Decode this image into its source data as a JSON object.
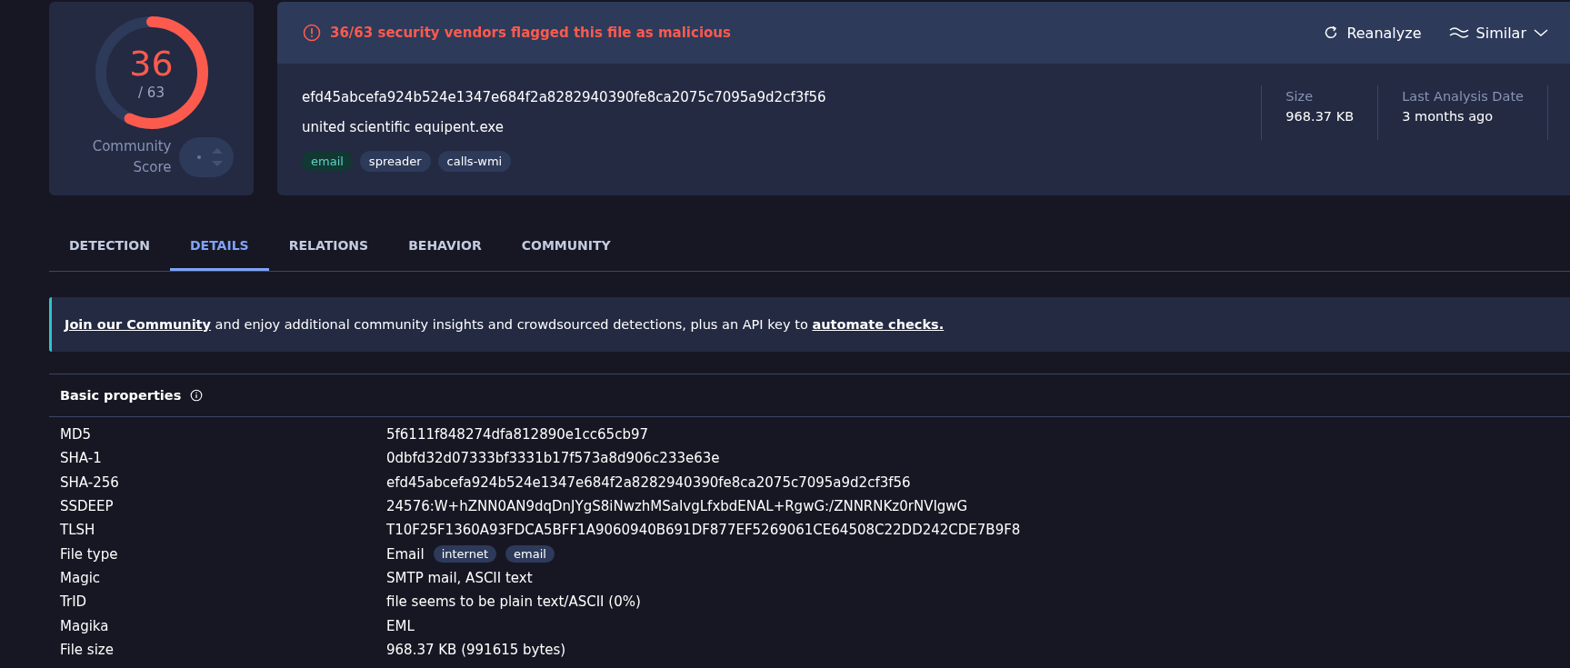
{
  "score": {
    "detections": "36",
    "total": "/ 63",
    "level": 0.571,
    "community_label": "Community Score"
  },
  "alert": {
    "text": "36/63 security vendors flagged this file as malicious"
  },
  "actions": [
    {
      "label": "Reanalyze",
      "kind": "reanalyze"
    },
    {
      "label": "Similar",
      "kind": "similar"
    }
  ],
  "file": {
    "hash": "efd45abcefa924b524e1347e684f2a8282940390fe8ca2075c7095a9d2cf3f56",
    "name": "united scientific equipent.exe",
    "tags": [
      {
        "label": "email",
        "kind": "accent"
      },
      {
        "label": "spreader",
        "kind": "plain"
      },
      {
        "label": "calls-wmi",
        "kind": "plain"
      }
    ]
  },
  "stats": [
    {
      "label": "Size",
      "value": "968.37 KB"
    },
    {
      "label": "Last Analysis Date",
      "value": "3 months ago"
    }
  ],
  "tabs": [
    {
      "label": "DETECTION",
      "selected": false
    },
    {
      "label": "DETAILS",
      "selected": true
    },
    {
      "label": "RELATIONS",
      "selected": false
    },
    {
      "label": "BEHAVIOR",
      "selected": false
    },
    {
      "label": "COMMUNITY",
      "selected": false
    }
  ],
  "banner": {
    "link1": "Join our Community",
    "text": " and enjoy additional community insights and crowdsourced detections, plus an API key to ",
    "link2": "automate checks."
  },
  "basic_properties": {
    "title": "Basic properties",
    "rows": [
      {
        "label": "MD5",
        "value": "5f6111f848274dfa812890e1cc65cb97"
      },
      {
        "label": "SHA-1",
        "value": "0dbfd32d07333bf3331b17f573a8d906c233e63e"
      },
      {
        "label": "SHA-256",
        "value": "efd45abcefa924b524e1347e684f2a8282940390fe8ca2075c7095a9d2cf3f56"
      },
      {
        "label": "SSDEEP",
        "value": "24576:W+hZNN0AN9dqDnJYgS8iNwzhMSaIvgLfxbdENAL+RgwG:/ZNNRNKz0rNVIgwG"
      },
      {
        "label": "TLSH",
        "value": "T10F25F1360A93FDCA5BFF1A9060940B691DF877EF5269061CE64508C22DD242CDE7B9F8"
      },
      {
        "label": "File type",
        "value": "Email",
        "tags": [
          "internet",
          "email"
        ]
      },
      {
        "label": "Magic",
        "value": "SMTP mail, ASCII text"
      },
      {
        "label": "TrID",
        "value": "file seems to be plain text/ASCII (0%)"
      },
      {
        "label": "Magika",
        "value": "EML"
      },
      {
        "label": "File size",
        "value": "968.37 KB (991615 bytes)"
      }
    ]
  }
}
